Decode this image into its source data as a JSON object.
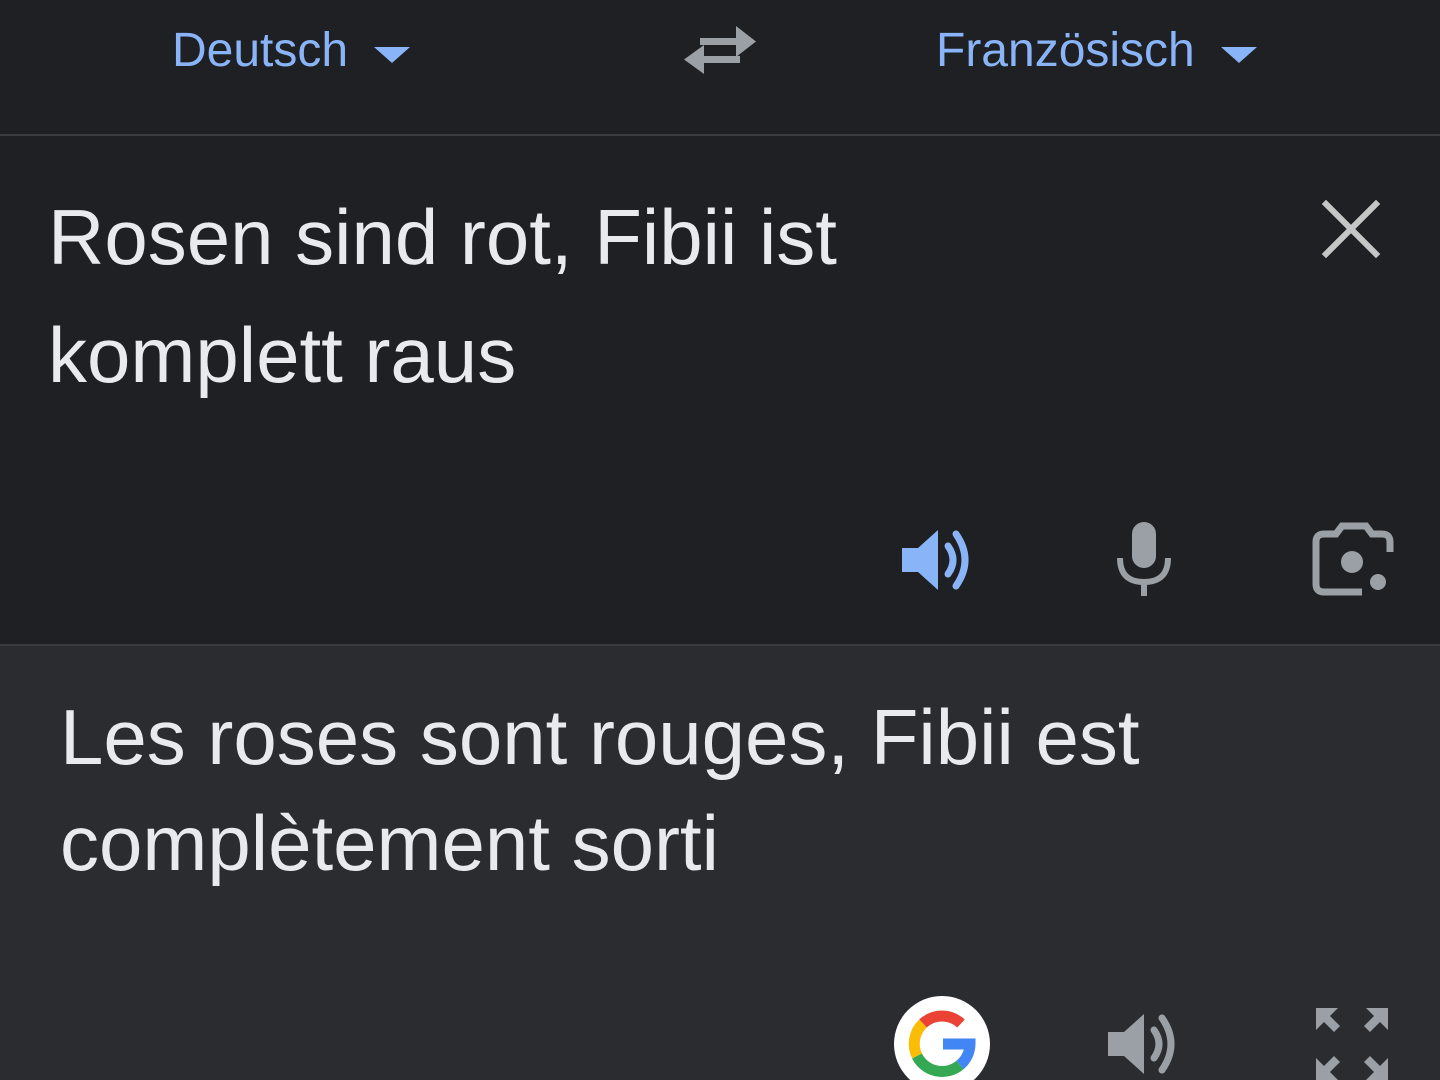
{
  "header": {
    "source_language": "Deutsch",
    "target_language": "Französisch"
  },
  "source": {
    "text": "Rosen sind rot, Fibii ist\nkomplett raus"
  },
  "target": {
    "text": "Les roses sont rouges, Fibii est\ncomplètement sorti"
  },
  "icons": {
    "swap": "swap-icon",
    "clear": "close-icon",
    "source_speaker": "speaker-icon",
    "microphone": "microphone-icon",
    "camera": "camera-icon",
    "google": "google-logo-icon",
    "target_speaker": "speaker-icon",
    "fullscreen": "fullscreen-icon"
  },
  "colors": {
    "accent": "#8ab4f8",
    "text": "#e8eaed",
    "icon_gray": "#9aa0a6",
    "bg_dark": "#1f2023",
    "bg_panel": "#2b2c30"
  }
}
